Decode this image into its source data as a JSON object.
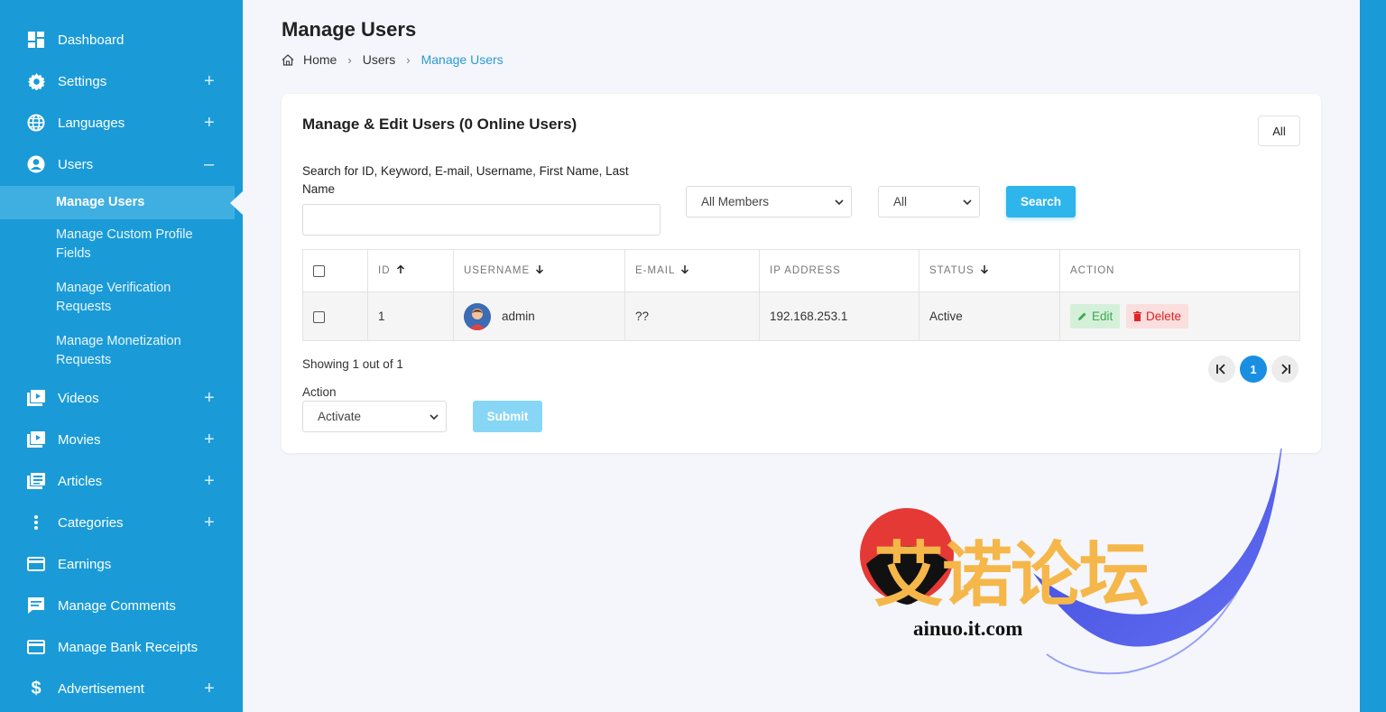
{
  "sidebar": {
    "items": [
      {
        "label": "Dashboard",
        "icon": "dashboard-icon",
        "expand": ""
      },
      {
        "label": "Settings",
        "icon": "gear-icon",
        "expand": "+"
      },
      {
        "label": "Languages",
        "icon": "globe-icon",
        "expand": "+"
      },
      {
        "label": "Users",
        "icon": "user-circle-icon",
        "expand": "–"
      },
      {
        "label": "Videos",
        "icon": "video-icon",
        "expand": "+"
      },
      {
        "label": "Movies",
        "icon": "video-icon",
        "expand": "+"
      },
      {
        "label": "Articles",
        "icon": "newspaper-icon",
        "expand": "+"
      },
      {
        "label": "Categories",
        "icon": "vertical-dots-icon",
        "expand": "+"
      },
      {
        "label": "Earnings",
        "icon": "credit-card-icon",
        "expand": ""
      },
      {
        "label": "Manage Comments",
        "icon": "comment-icon",
        "expand": ""
      },
      {
        "label": "Manage Bank Receipts",
        "icon": "credit-card-icon",
        "expand": ""
      },
      {
        "label": "Advertisement",
        "icon": "dollar-icon",
        "expand": "+"
      }
    ],
    "users_sub": [
      "Manage Users",
      "Manage Custom Profile Fields",
      "Manage Verification Requests",
      "Manage Monetization Requests"
    ]
  },
  "header": {
    "title": "Manage Users",
    "breadcrumb": [
      "Home",
      "Users",
      "Manage Users"
    ]
  },
  "card": {
    "title": "Manage & Edit Users (0 Online Users)",
    "all_button": "All",
    "search_label": "Search for ID, Keyword, E-mail, Username, First Name, Last Name",
    "search_value": "",
    "members_select": "All Members",
    "status_select": "All",
    "search_button": "Search"
  },
  "table": {
    "columns": [
      "ID",
      "USERNAME",
      "E-MAIL",
      "IP ADDRESS",
      "STATUS",
      "ACTION"
    ],
    "rows": [
      {
        "id": "1",
        "username": "admin",
        "email": "??",
        "ip": "192.168.253.1",
        "status": "Active",
        "edit": "Edit",
        "delete": "Delete"
      }
    ]
  },
  "footer": {
    "showing": "Showing 1 out of 1",
    "action_label": "Action",
    "action_select": "Activate",
    "submit": "Submit",
    "current_page": "1"
  },
  "watermark": {
    "text": "艾诺论坛",
    "url": "ainuo.it.com"
  },
  "colors": {
    "sidebar": "#1a9bd7",
    "accent": "#2eb5ec",
    "page_bg": "#f4f6fb"
  }
}
